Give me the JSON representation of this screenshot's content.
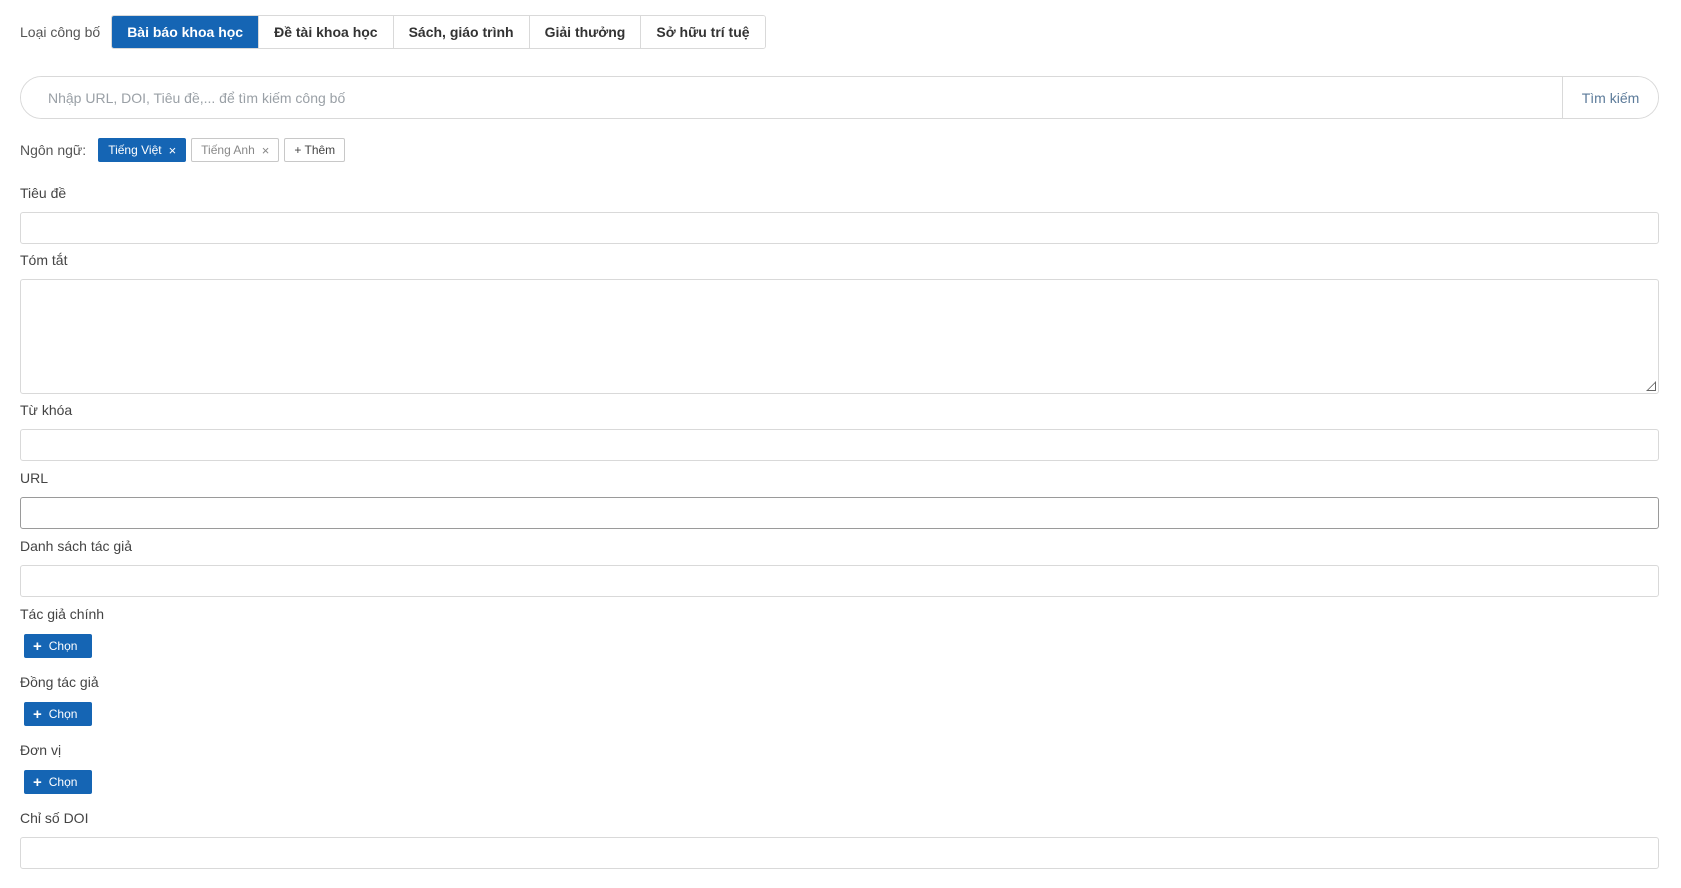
{
  "publication_type": {
    "label": "Loại công bố",
    "tabs": [
      {
        "label": "Bài báo khoa học",
        "active": true
      },
      {
        "label": "Đề tài khoa học",
        "active": false
      },
      {
        "label": "Sách, giáo trình",
        "active": false
      },
      {
        "label": "Giải thưởng",
        "active": false
      },
      {
        "label": "Sở hữu trí tuệ",
        "active": false
      }
    ]
  },
  "search": {
    "placeholder": "Nhập URL, DOI, Tiêu đề,... để tìm kiếm công bố",
    "button_label": "Tìm kiếm"
  },
  "language": {
    "label": "Ngôn ngữ:",
    "tags": [
      {
        "label": "Tiếng Việt",
        "selected": true,
        "remove": "×"
      },
      {
        "label": "Tiếng Anh",
        "selected": false,
        "remove": "×"
      }
    ],
    "add_label": "+ Thêm"
  },
  "form": {
    "title_label": "Tiêu đề",
    "abstract_label": "Tóm tắt",
    "keywords_label": "Từ khóa",
    "url_label": "URL",
    "authors_list_label": "Danh sách tác giả",
    "main_author_label": "Tác giả chính",
    "co_author_label": "Đồng tác giả",
    "unit_label": "Đơn vị",
    "doi_label": "Chỉ số DOI",
    "choose_label": "Chọn",
    "choose_icon": "+"
  },
  "colors": {
    "primary": "#1565b4",
    "border": "#d9d9d9"
  }
}
